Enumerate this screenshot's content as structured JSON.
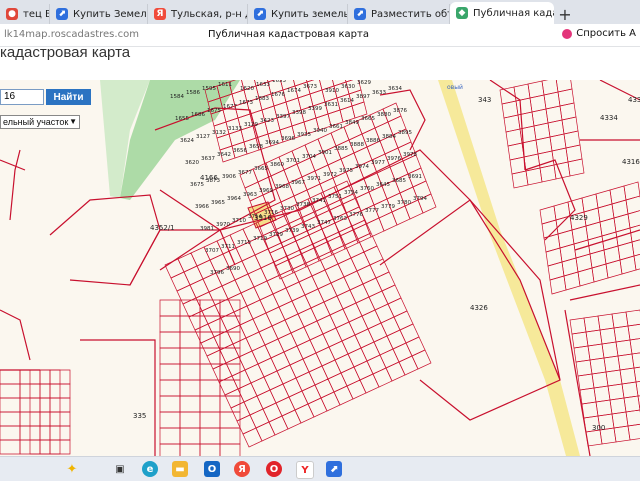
{
  "browser": {
    "tabs": [
      {
        "label": "тец Брауз",
        "icon": "browser-icon",
        "color": "#e0473a"
      },
      {
        "label": "Купить Земельный",
        "icon": "marker-icon",
        "color": "#2f6fdd"
      },
      {
        "label": "Тульская, р-н Дубе",
        "icon": "yandex-icon",
        "color": "#f04a3a"
      },
      {
        "label": "Купить земельный",
        "icon": "marker-icon",
        "color": "#2f6fdd"
      },
      {
        "label": "Разместить объявл",
        "icon": "marker-icon",
        "color": "#2f6fdd"
      },
      {
        "label": "Публичная кадас",
        "icon": "map-icon",
        "color": "#3aa66b",
        "active": true
      }
    ],
    "new_tab": "+",
    "close_tab": "×",
    "url": "lk14map.roscadastres.com",
    "page_title": "Публичная кадастровая карта",
    "subscribe_label": "Спросить А"
  },
  "page": {
    "title": "кадастровая карта",
    "search_value": "16",
    "search_button": "Найти",
    "type_select": "ельный участок"
  },
  "map": {
    "parcel_labels": [
      "1584",
      "1586",
      "1595",
      "1611",
      "1620",
      "1633",
      "1653",
      "1665",
      "1667",
      "1654",
      "1632",
      "1610",
      "1647",
      "1649",
      "1655",
      "1686",
      "1675",
      "1677",
      "1673",
      "1683",
      "1676",
      "1674",
      "3673",
      "3910",
      "3630",
      "3629",
      "3628",
      "3625",
      "3624",
      "343",
      "3127",
      "3132",
      "3133",
      "3129",
      "4333",
      "4334",
      "4316",
      "4329",
      "3423",
      "3397",
      "3398",
      "3399",
      "4166",
      "4352/1",
      "3916",
      "3631",
      "3614",
      "3897",
      "3633",
      "3634",
      "3620",
      "3637",
      "3642",
      "3656",
      "3658",
      "3694",
      "3696",
      "3935",
      "3940",
      "3661",
      "3849",
      "3665",
      "3880",
      "3876",
      "3675",
      "3873",
      "3906",
      "3677",
      "3665",
      "3860",
      "3701",
      "3704",
      "4326",
      "3901",
      "3885",
      "3888",
      "3886",
      "3884",
      "3895",
      "3966",
      "3965",
      "3964",
      "3963",
      "3969",
      "3968",
      "3967",
      "3971",
      "3972",
      "3975",
      "3974",
      "3977",
      "3976",
      "3978",
      "3981",
      "3970",
      "335",
      "300",
      "3710",
      "3714",
      "3716",
      "3730",
      "3738",
      "3741",
      "3751",
      "3754",
      "3760",
      "3645",
      "3685",
      "3691",
      "3707",
      "3711",
      "3715",
      "3719",
      "3729",
      "3739",
      "3743",
      "3747",
      "3763",
      "3776",
      "3777",
      "3779",
      "3780",
      "3794",
      "3796",
      "3690"
    ],
    "water_label": "овый",
    "colors": {
      "parcel_stroke": "#c8102e",
      "green": "#8fce8a",
      "road": "#f6e99a",
      "highlight": "#f5dd8a"
    }
  },
  "taskbar": {
    "icons": [
      "sparkle-icon",
      "task-view-icon",
      "edge-icon",
      "explorer-icon",
      "outlook-icon",
      "yandex-icon",
      "opera-icon",
      "yandex-browser-icon",
      "maps-icon"
    ]
  }
}
